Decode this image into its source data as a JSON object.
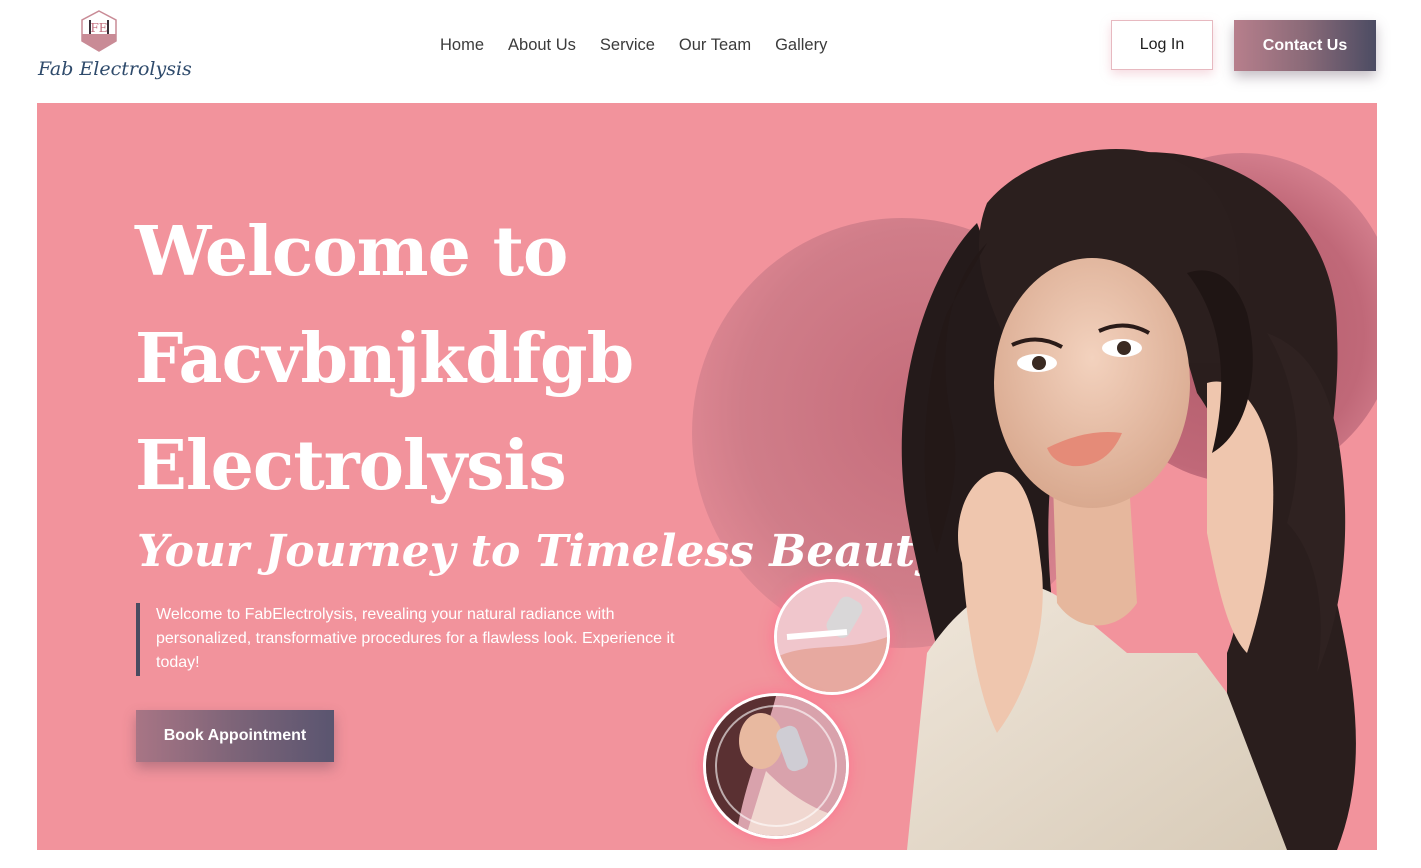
{
  "brand": {
    "logo_text": "Fab Electrolysis",
    "logo_monogram": "FE"
  },
  "nav": {
    "items": [
      {
        "label": "Home"
      },
      {
        "label": "About Us"
      },
      {
        "label": "Service"
      },
      {
        "label": "Our Team"
      },
      {
        "label": "Gallery"
      }
    ]
  },
  "header": {
    "login_label": "Log In",
    "contact_label": "Contact Us"
  },
  "hero": {
    "headline_line1": "Welcome to",
    "headline_line2": "Facvbnjkdfgb",
    "headline_line3": "Electrolysis",
    "tagline": "Your Journey to Timeless Beauty",
    "lead": "Welcome to FabElectrolysis, revealing your natural radiance with personalized, transformative procedures for a flawless look. Experience it today!",
    "cta_label": "Book Appointment"
  },
  "colors": {
    "hero_bg": "#f2939c",
    "accent_dark": "#4a4b60",
    "accent_mauve": "#b77f8c",
    "text_nav": "#3b3b3b"
  }
}
